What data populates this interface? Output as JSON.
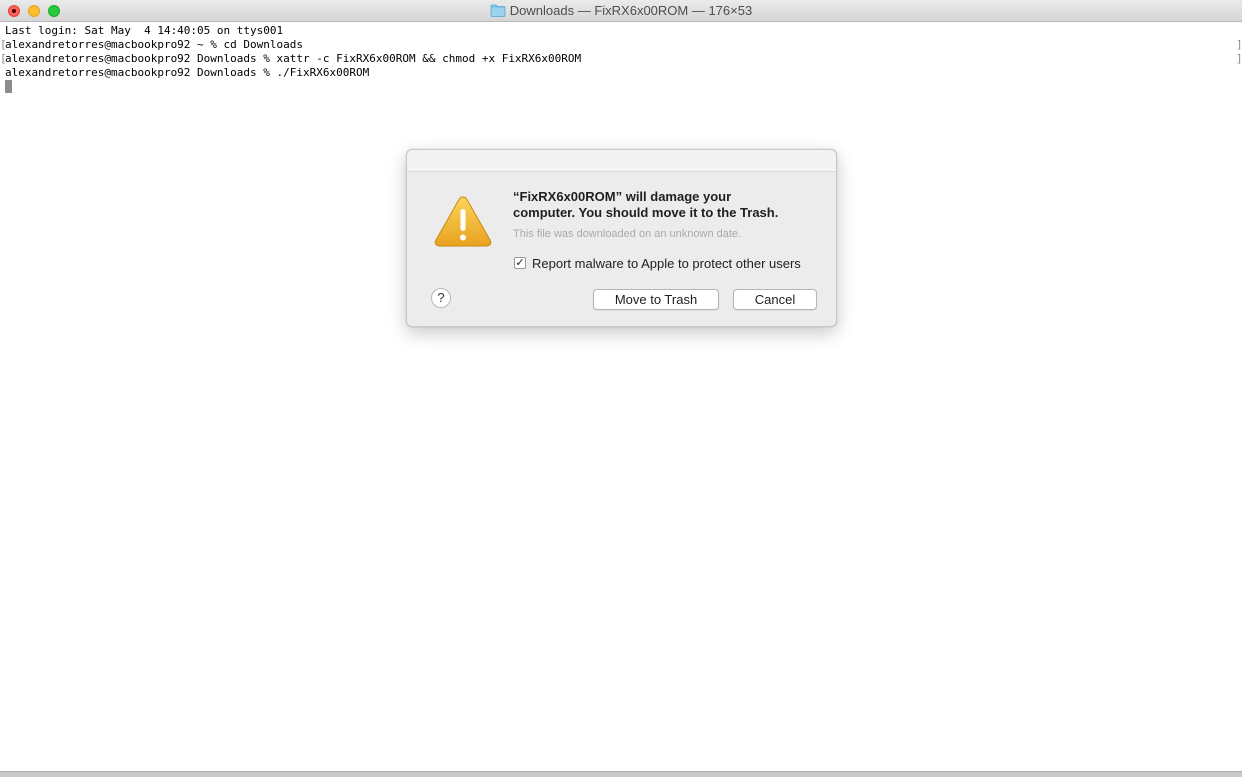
{
  "window": {
    "title": "Downloads — FixRX6x00ROM — 176×53"
  },
  "terminal": {
    "lines": [
      "Last login: Sat May  4 14:40:05 on ttys001",
      "alexandretorres@macbookpro92 ~ % cd Downloads",
      "alexandretorres@macbookpro92 Downloads % xattr -c FixRX6x00ROM && chmod +x FixRX6x00ROM",
      "alexandretorres@macbookpro92 Downloads % ./FixRX6x00ROM"
    ]
  },
  "dialog": {
    "icon": "warning-icon",
    "title_line1": "“FixRX6x00ROM” will damage your",
    "title_line2": "computer. You should move it to the Trash.",
    "subtitle": "This file was downloaded on an unknown date.",
    "checkbox_label": "Report malware to Apple to protect other users",
    "checkbox_checked": true,
    "checkbox_mark": "✓",
    "help_label": "?",
    "move_to_trash_label": "Move to Trash",
    "cancel_label": "Cancel"
  },
  "colors": {
    "close": "#fe5f57",
    "minimize": "#febc2e",
    "maximize": "#28c840",
    "warning": "#f0b429"
  }
}
